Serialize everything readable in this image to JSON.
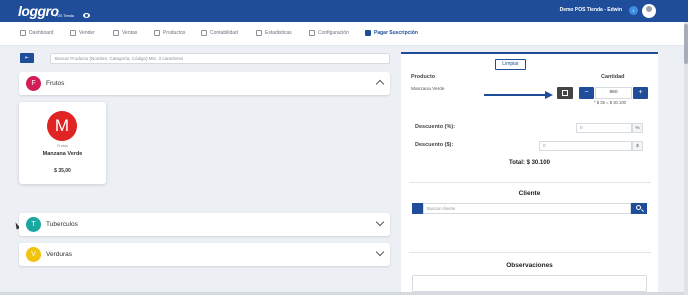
{
  "header": {
    "logo_text": "loggro",
    "logo_sub": "POS Tienda",
    "store_user": "Demo POS Tienda - Edwin",
    "badge": "1"
  },
  "nav": {
    "items": [
      {
        "label": "Dashboard"
      },
      {
        "label": "Vender"
      },
      {
        "label": "Ventas"
      },
      {
        "label": "Productos"
      },
      {
        "label": "Contabilidad"
      },
      {
        "label": "Estadisticas"
      },
      {
        "label": "Configuración"
      },
      {
        "label": "Pagar Suscripción"
      }
    ]
  },
  "left": {
    "toggle_label": "⇤",
    "search_placeholder": "Buscar Producto (Nombre, Categoría, Código) Min. 3 caracteres",
    "categories": [
      {
        "letter": "F",
        "name": "Frutos",
        "color": "#d11e57",
        "expanded": true
      },
      {
        "letter": "T",
        "name": "Tuberculos",
        "color": "#19a7a0",
        "expanded": false
      },
      {
        "letter": "V",
        "name": "Verduras",
        "color": "#f2c30f",
        "expanded": false
      }
    ],
    "product": {
      "letter": "M",
      "category": "Frutos",
      "name": "Manzana Verde",
      "price": "$ 35,00",
      "color": "#e02424"
    }
  },
  "right": {
    "clear_label": "Limpiar",
    "col_product": "Producto",
    "col_qty": "Cantidad",
    "item": {
      "name": "Manzana Verde",
      "qty": "860",
      "calc": "* $ 35 = $ 30.100"
    },
    "discount_pct_label": "Descuento (%):",
    "discount_pct_value": "0",
    "discount_pct_unit": "%",
    "discount_amt_label": "Descuento ($):",
    "discount_amt_value": "0",
    "discount_amt_unit": "$",
    "total": "Total: $ 30.100",
    "client_title": "Cliente",
    "client_placeholder": "Buscar cliente",
    "obs_title": "Observaciones"
  },
  "colors": {
    "primary": "#1f4d9a",
    "background": "#eceff4"
  }
}
